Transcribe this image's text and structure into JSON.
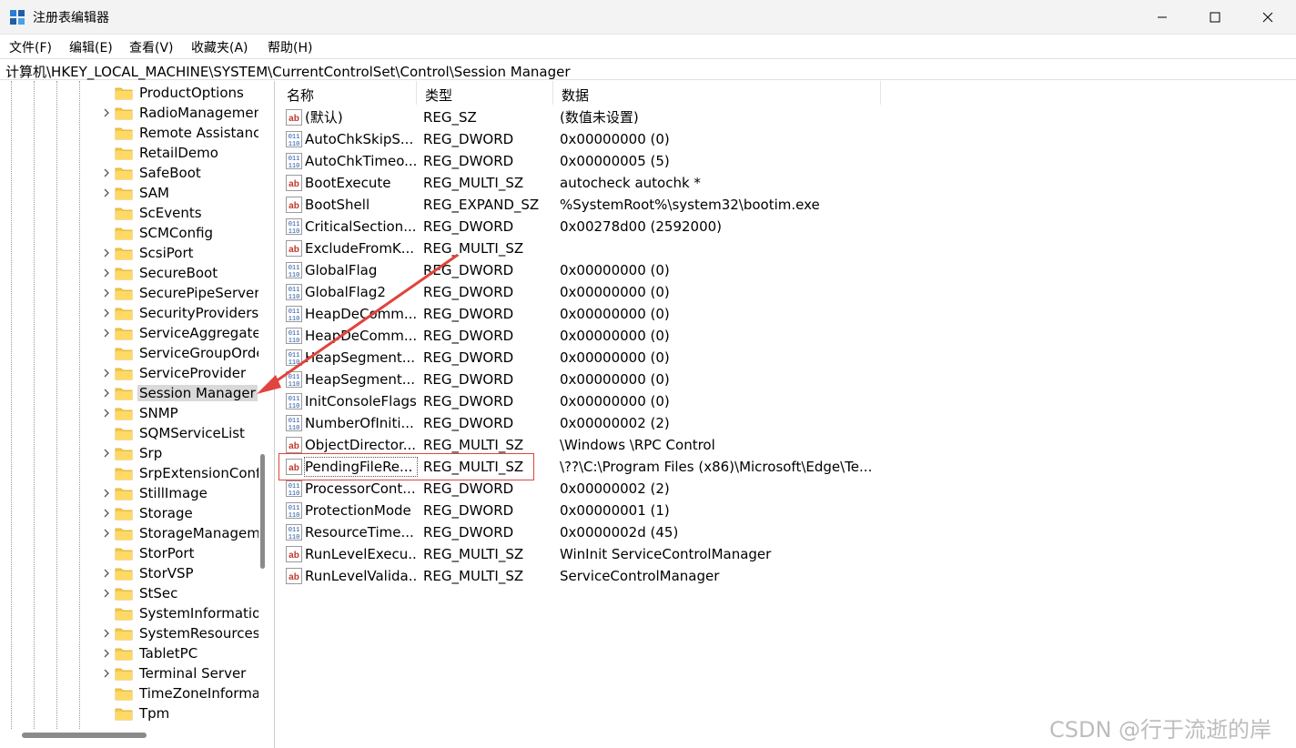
{
  "window": {
    "title": "注册表编辑器",
    "app_icon": "registry-editor-icon",
    "controls": {
      "minimize": "minimize-icon",
      "maximize": "maximize-icon",
      "close": "close-icon"
    }
  },
  "menu": [
    "文件(F)",
    "编辑(E)",
    "查看(V)",
    "收藏夹(A)",
    "帮助(H)"
  ],
  "address": "计算机\\HKEY_LOCAL_MACHINE\\SYSTEM\\CurrentControlSet\\Control\\Session Manager",
  "tree": {
    "items": [
      {
        "label": "ProductOptions",
        "expandable": false
      },
      {
        "label": "RadioManagement",
        "expandable": true
      },
      {
        "label": "Remote Assistance",
        "expandable": false
      },
      {
        "label": "RetailDemo",
        "expandable": false
      },
      {
        "label": "SafeBoot",
        "expandable": true
      },
      {
        "label": "SAM",
        "expandable": true
      },
      {
        "label": "ScEvents",
        "expandable": false
      },
      {
        "label": "SCMConfig",
        "expandable": false
      },
      {
        "label": "ScsiPort",
        "expandable": true
      },
      {
        "label": "SecureBoot",
        "expandable": true
      },
      {
        "label": "SecurePipeServers",
        "expandable": true
      },
      {
        "label": "SecurityProviders",
        "expandable": true
      },
      {
        "label": "ServiceAggregatedEvents",
        "expandable": true
      },
      {
        "label": "ServiceGroupOrder",
        "expandable": false
      },
      {
        "label": "ServiceProvider",
        "expandable": true
      },
      {
        "label": "Session Manager",
        "expandable": true,
        "selected": true
      },
      {
        "label": "SNMP",
        "expandable": true
      },
      {
        "label": "SQMServiceList",
        "expandable": false
      },
      {
        "label": "Srp",
        "expandable": true
      },
      {
        "label": "SrpExtensionConfig",
        "expandable": false
      },
      {
        "label": "StillImage",
        "expandable": true
      },
      {
        "label": "Storage",
        "expandable": true
      },
      {
        "label": "StorageManagement",
        "expandable": true
      },
      {
        "label": "StorPort",
        "expandable": false
      },
      {
        "label": "StorVSP",
        "expandable": true
      },
      {
        "label": "StSec",
        "expandable": true
      },
      {
        "label": "SystemInformation",
        "expandable": false
      },
      {
        "label": "SystemResources",
        "expandable": true
      },
      {
        "label": "TabletPC",
        "expandable": true
      },
      {
        "label": "Terminal Server",
        "expandable": true
      },
      {
        "label": "TimeZoneInformation",
        "expandable": false
      },
      {
        "label": "Tpm",
        "expandable": false
      }
    ]
  },
  "list": {
    "columns": [
      "名称",
      "类型",
      "数据"
    ],
    "rows": [
      {
        "icon": "string-value-icon",
        "name": "(默认)",
        "type": "REG_SZ",
        "data": "(数值未设置)"
      },
      {
        "icon": "binary-value-icon",
        "name": "AutoChkSkipS...",
        "type": "REG_DWORD",
        "data": "0x00000000 (0)"
      },
      {
        "icon": "binary-value-icon",
        "name": "AutoChkTimeo...",
        "type": "REG_DWORD",
        "data": "0x00000005 (5)"
      },
      {
        "icon": "string-value-icon",
        "name": "BootExecute",
        "type": "REG_MULTI_SZ",
        "data": "autocheck autochk *"
      },
      {
        "icon": "string-value-icon",
        "name": "BootShell",
        "type": "REG_EXPAND_SZ",
        "data": "%SystemRoot%\\system32\\bootim.exe"
      },
      {
        "icon": "binary-value-icon",
        "name": "CriticalSection...",
        "type": "REG_DWORD",
        "data": "0x00278d00 (2592000)"
      },
      {
        "icon": "string-value-icon",
        "name": "ExcludeFromK...",
        "type": "REG_MULTI_SZ",
        "data": ""
      },
      {
        "icon": "binary-value-icon",
        "name": "GlobalFlag",
        "type": "REG_DWORD",
        "data": "0x00000000 (0)"
      },
      {
        "icon": "binary-value-icon",
        "name": "GlobalFlag2",
        "type": "REG_DWORD",
        "data": "0x00000000 (0)"
      },
      {
        "icon": "binary-value-icon",
        "name": "HeapDeComm...",
        "type": "REG_DWORD",
        "data": "0x00000000 (0)"
      },
      {
        "icon": "binary-value-icon",
        "name": "HeapDeComm...",
        "type": "REG_DWORD",
        "data": "0x00000000 (0)"
      },
      {
        "icon": "binary-value-icon",
        "name": "HeapSegment...",
        "type": "REG_DWORD",
        "data": "0x00000000 (0)"
      },
      {
        "icon": "binary-value-icon",
        "name": "HeapSegment...",
        "type": "REG_DWORD",
        "data": "0x00000000 (0)"
      },
      {
        "icon": "binary-value-icon",
        "name": "InitConsoleFlags",
        "type": "REG_DWORD",
        "data": "0x00000000 (0)"
      },
      {
        "icon": "binary-value-icon",
        "name": "NumberOfIniti...",
        "type": "REG_DWORD",
        "data": "0x00000002 (2)"
      },
      {
        "icon": "string-value-icon",
        "name": "ObjectDirector...",
        "type": "REG_MULTI_SZ",
        "data": "\\Windows \\RPC Control"
      },
      {
        "icon": "string-value-icon",
        "name": "PendingFileRe...",
        "type": "REG_MULTI_SZ",
        "data": "\\??\\C:\\Program Files (x86)\\Microsoft\\Edge\\Te...",
        "focused": true,
        "highlighted": true
      },
      {
        "icon": "binary-value-icon",
        "name": "ProcessorCont...",
        "type": "REG_DWORD",
        "data": "0x00000002 (2)"
      },
      {
        "icon": "binary-value-icon",
        "name": "ProtectionMode",
        "type": "REG_DWORD",
        "data": "0x00000001 (1)"
      },
      {
        "icon": "binary-value-icon",
        "name": "ResourceTime...",
        "type": "REG_DWORD",
        "data": "0x0000002d (45)"
      },
      {
        "icon": "string-value-icon",
        "name": "RunLevelExecu...",
        "type": "REG_MULTI_SZ",
        "data": "WinInit ServiceControlManager"
      },
      {
        "icon": "string-value-icon",
        "name": "RunLevelValida...",
        "type": "REG_MULTI_SZ",
        "data": "ServiceControlManager"
      }
    ]
  },
  "annotation": {
    "color": "#e0443e",
    "arrow_icon": "red-arrow-annotation"
  },
  "watermark": "CSDN @行于流逝的岸"
}
